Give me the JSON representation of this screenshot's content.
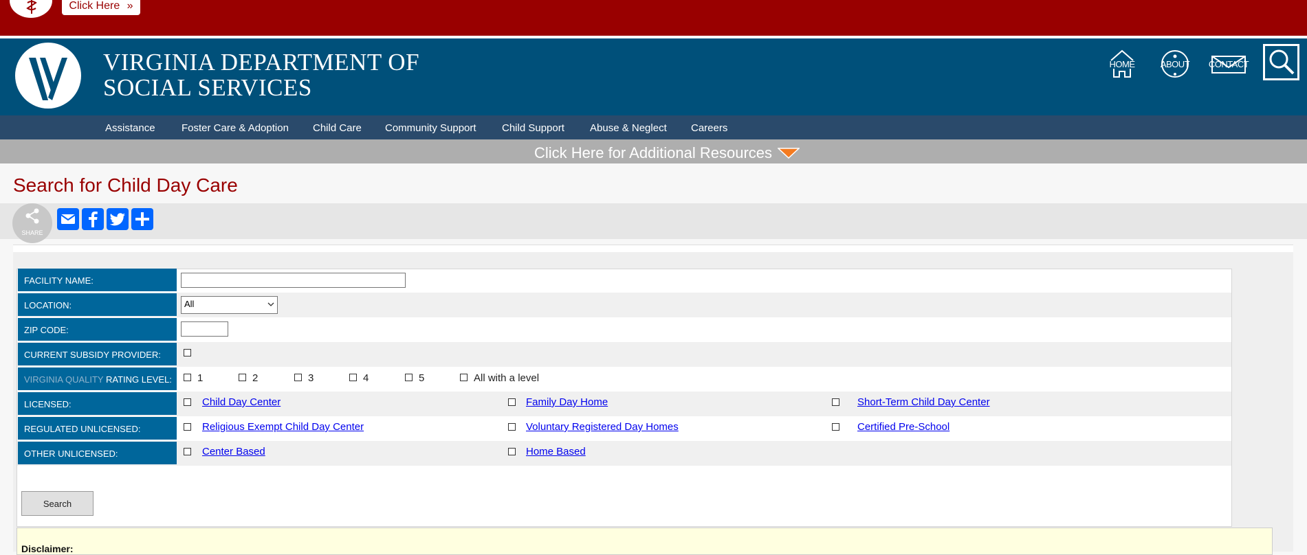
{
  "alert": {
    "button_label": "Click Here",
    "button_chevron": "»"
  },
  "header": {
    "agency_line1": "VIRGINIA DEPARTMENT OF",
    "agency_line2": "SOCIAL SERVICES",
    "links": {
      "home": "HOME",
      "about": "ABOUT",
      "contact": "CONTACT"
    }
  },
  "nav": {
    "items": [
      "Assistance",
      "Foster Care & Adoption",
      "Child Care",
      "Community Support",
      "Child Support",
      "Abuse & Neglect",
      "Careers"
    ]
  },
  "resources": {
    "label": "Click Here for Additional Resources"
  },
  "page": {
    "title": "Search for Child Day Care"
  },
  "share": {
    "label": "SHARE"
  },
  "form": {
    "facility_name": {
      "label": "FACILITY NAME:",
      "value": ""
    },
    "location": {
      "label": "LOCATION:",
      "selected": "All"
    },
    "zip": {
      "label": "ZIP CODE:",
      "value": ""
    },
    "subsidy": {
      "label": "CURRENT SUBSIDY PROVIDER:"
    },
    "quality": {
      "label_dim": "VIRGINIA QUALITY",
      "label_rest": "RATING LEVEL:",
      "levels": [
        "1",
        "2",
        "3",
        "4",
        "5",
        "All with a level"
      ]
    },
    "licensed": {
      "label": "LICENSED:",
      "options": [
        "Child Day Center",
        "Family Day Home",
        "Short-Term Child Day Center"
      ]
    },
    "regulated": {
      "label": "REGULATED UNLICENSED:",
      "options": [
        "Religious Exempt Child Day Center",
        "Voluntary Registered Day Homes",
        "Certified Pre-School"
      ]
    },
    "other": {
      "label": "OTHER UNLICENSED:",
      "options": [
        "Center Based",
        "Home Based"
      ]
    },
    "search_button": "Search"
  },
  "disclaimer": {
    "title": "Disclaimer:"
  },
  "colors": {
    "alert_red": "#990000",
    "header_blue": "#00507a",
    "nav_blue": "#2a4a6b",
    "label_blue": "#00669b",
    "title_red": "#990000",
    "share_blue": "#0166ff",
    "accent_orange": "#f47b20"
  }
}
